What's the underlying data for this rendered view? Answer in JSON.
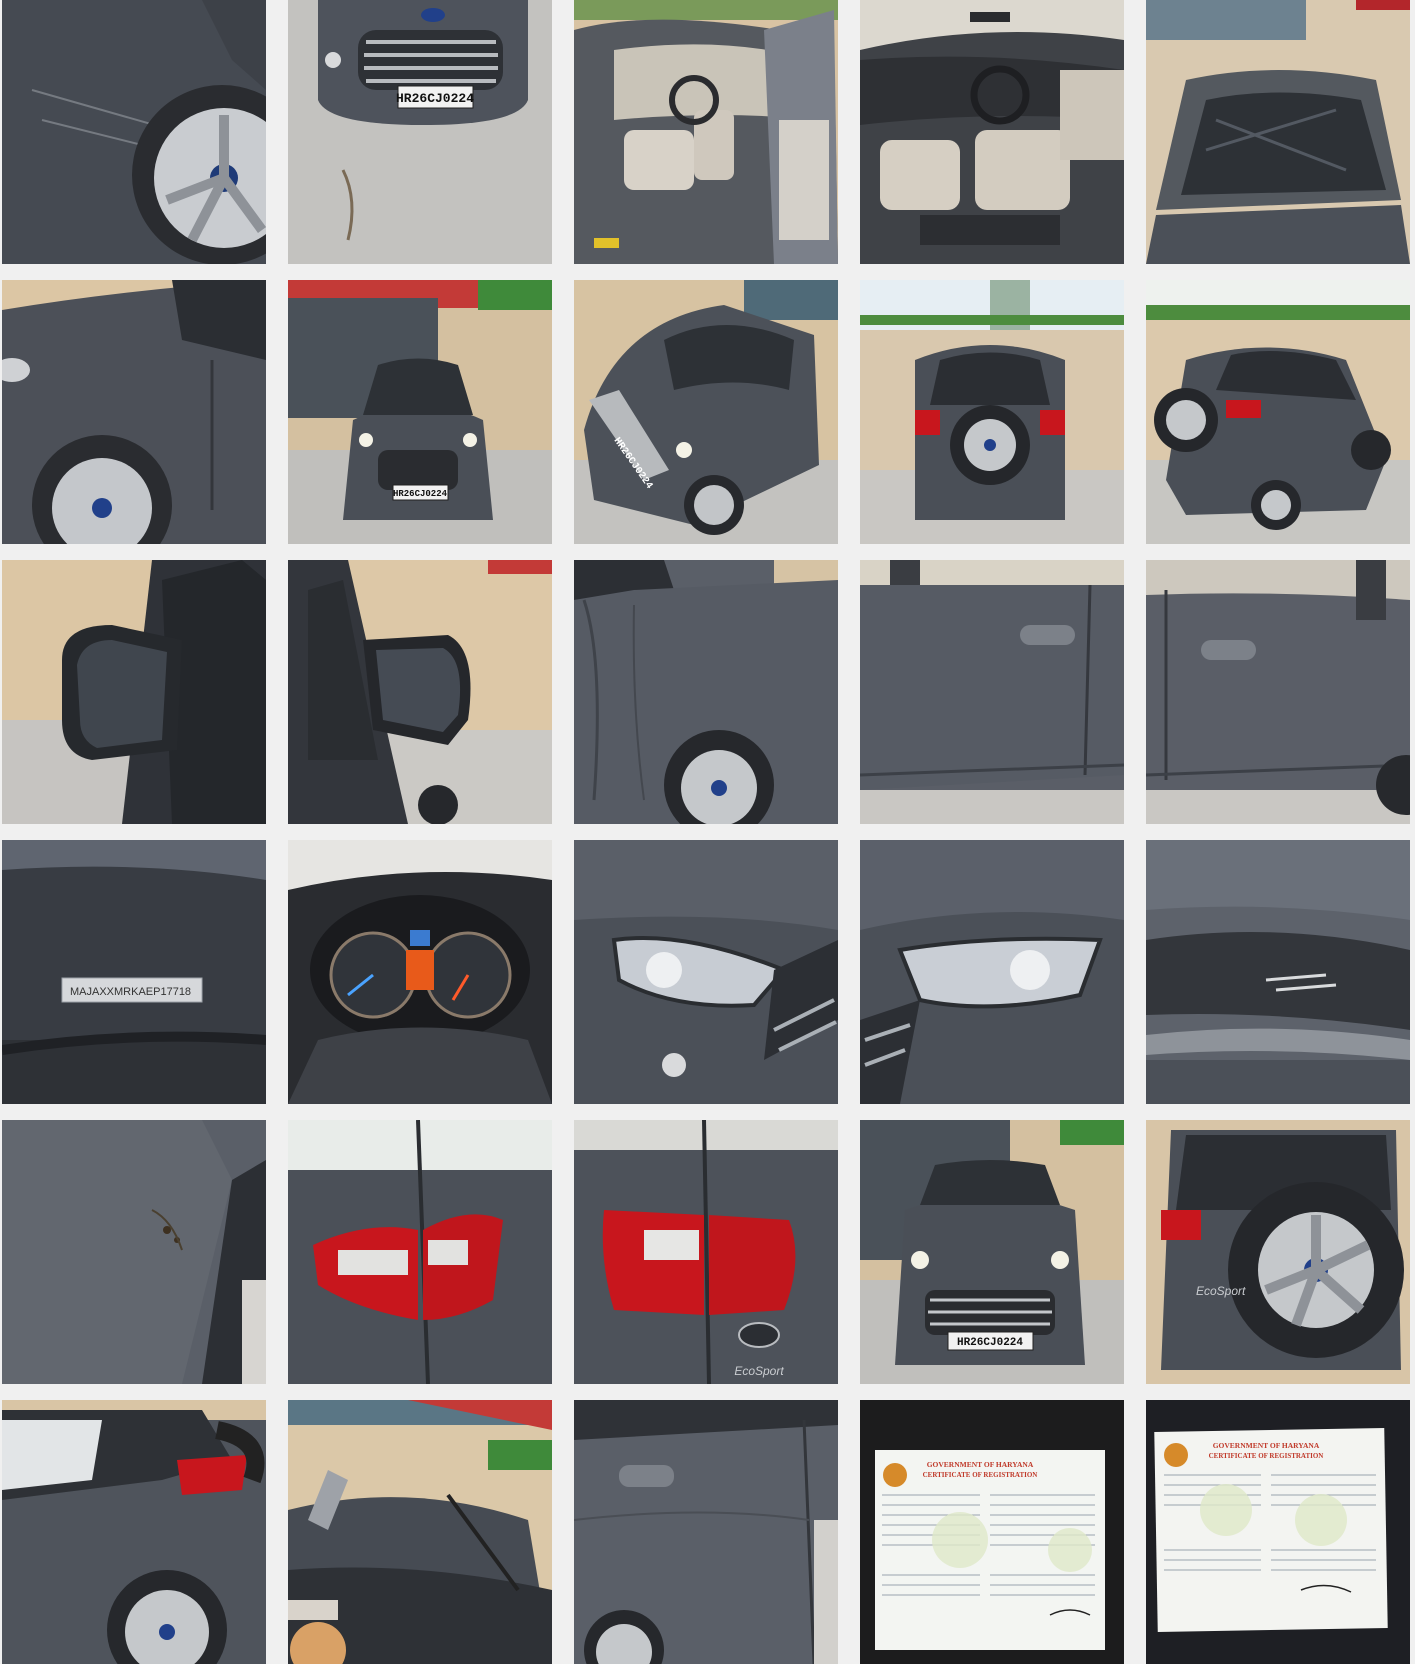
{
  "gallery": {
    "plate": "HR26CJ0224",
    "vin": "MAJAXXMRKAEP17718",
    "rc_header": "GOVERNMENT OF HARYANA",
    "rc_title": "CERTIFICATE OF REGISTRATION",
    "badge_text": "EcoSport",
    "brand": "Ford"
  },
  "photos": [
    {
      "subject": "front-wheel-scratch"
    },
    {
      "subject": "front-grille-plate"
    },
    {
      "subject": "interior-driver-door-open"
    },
    {
      "subject": "interior-dashboard-seats"
    },
    {
      "subject": "windshield-top"
    },
    {
      "subject": "front-left-fender"
    },
    {
      "subject": "front-view-garage"
    },
    {
      "subject": "front-angle-view"
    },
    {
      "subject": "rear-view-spare-wheel"
    },
    {
      "subject": "rear-angle-view"
    },
    {
      "subject": "left-side-mirror"
    },
    {
      "subject": "right-side-mirror"
    },
    {
      "subject": "front-right-quarter"
    },
    {
      "subject": "front-door-handle"
    },
    {
      "subject": "rear-door-handle"
    },
    {
      "subject": "vin-plate-windshield"
    },
    {
      "subject": "instrument-cluster"
    },
    {
      "subject": "left-headlamp"
    },
    {
      "subject": "right-headlamp"
    },
    {
      "subject": "bumper-scratch"
    },
    {
      "subject": "panel-scuff"
    },
    {
      "subject": "tail-lamp-left"
    },
    {
      "subject": "tail-lamp-right"
    },
    {
      "subject": "front-view-wide"
    },
    {
      "subject": "rear-spare-wheel-closeup"
    },
    {
      "subject": "rear-quarter-tail"
    },
    {
      "subject": "roof-antenna"
    },
    {
      "subject": "rear-door-side"
    },
    {
      "subject": "registration-certificate-front"
    },
    {
      "subject": "registration-certificate-back"
    }
  ],
  "colors": {
    "background": "#f0f0f0",
    "car_body": "#4e535c",
    "tail_red": "#c8161d",
    "wall": "#dcc6a6"
  }
}
